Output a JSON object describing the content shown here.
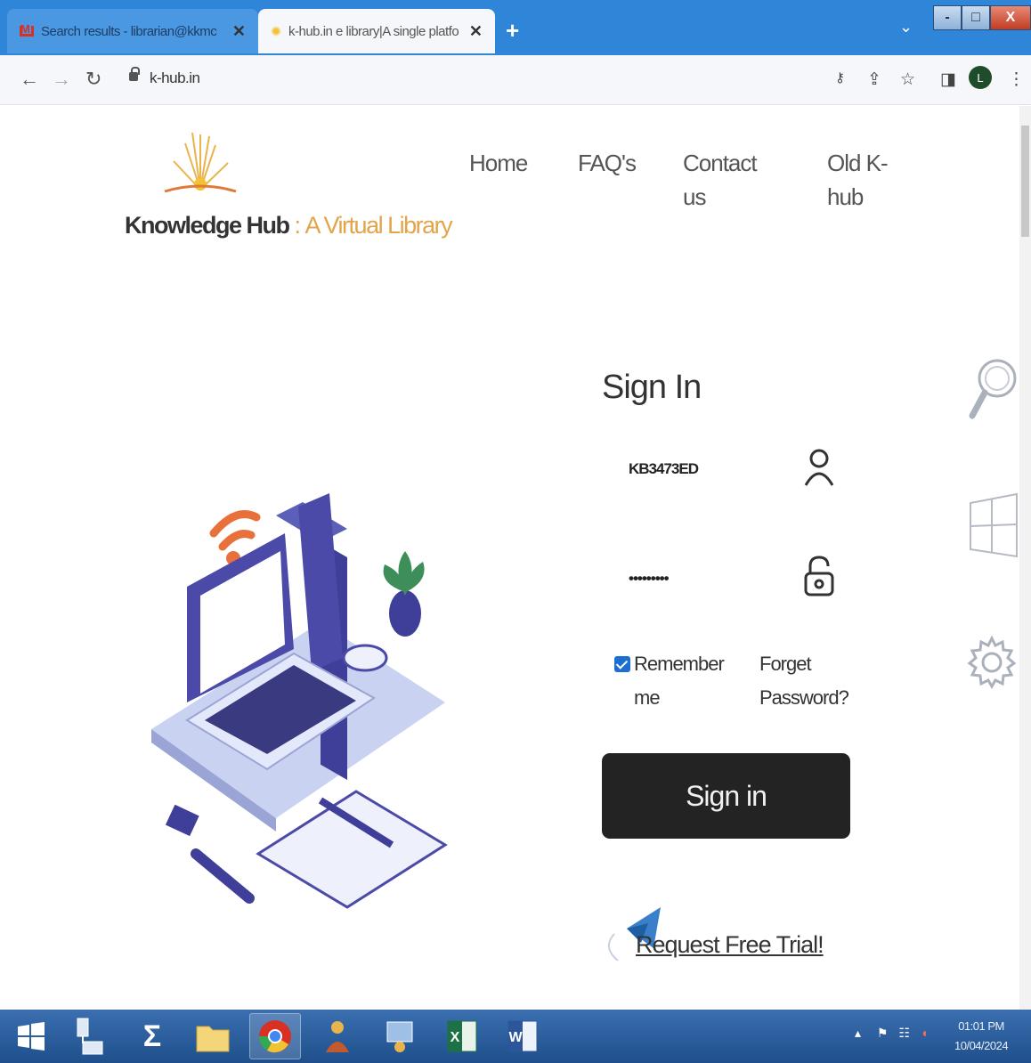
{
  "browser": {
    "tabs": [
      {
        "title": "Search results - librarian@kkmc",
        "active": false
      },
      {
        "title": "k-hub.in e library|A single platfo",
        "active": true
      }
    ],
    "new_tab": "+",
    "url": "k-hub.in",
    "profile_initial": "L",
    "window_buttons": {
      "minimize": "-",
      "maximize": "□",
      "close": "X"
    }
  },
  "site": {
    "logo": {
      "name": "Knowledge Hub",
      "separator": ":",
      "tagline": "A Virtual Library"
    },
    "nav": {
      "home": "Home",
      "faq": "FAQ's",
      "contact_line1": "Contact",
      "contact_line2": "us",
      "oldkhub_line1": "Old K-",
      "oldkhub_line2": "hub"
    },
    "signin": {
      "title": "Sign In",
      "username": "KB3473ED",
      "password_mask": "•••••••••",
      "remember_line1": "Remember",
      "remember_line2": "me",
      "remember_checked": true,
      "forgot_line1": "Forget",
      "forgot_line2": "Password?",
      "button": "Sign in",
      "trial": "Request Free Trial!"
    },
    "side_icons": [
      "search-icon",
      "windows-icon",
      "gear-icon"
    ]
  },
  "taskbar": {
    "clock_time": "01:01 PM",
    "clock_date": "10/04/2024"
  },
  "colors": {
    "tabstrip": "#2f86d8",
    "brand_orange": "#e3a44a",
    "button_dark": "#232323",
    "checkbox": "#1c6fd1",
    "illustration_purple": "#4b4aa8"
  }
}
